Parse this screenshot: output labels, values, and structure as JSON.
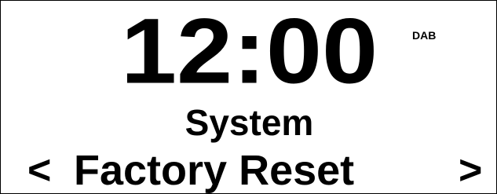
{
  "display": {
    "time": "12:00",
    "source": "DAB",
    "menu_title": "System",
    "selected_item": "Factory Reset",
    "nav_prev": "<",
    "nav_next": ">"
  },
  "colors": {
    "background": "#ffffff",
    "foreground": "#000000"
  }
}
